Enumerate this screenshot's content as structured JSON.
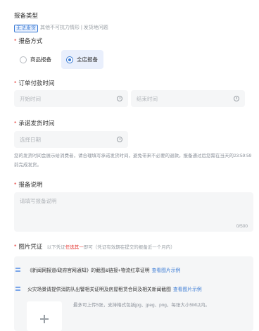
{
  "report_type": {
    "label": "报备类型",
    "selected_tag": "无法发货",
    "others": "其他不可抗力情形 | 发货地问题"
  },
  "report_method": {
    "label": "报备方式",
    "options": [
      "商品报备",
      "全店报备"
    ],
    "selected": "全店报备"
  },
  "order_paid_time": {
    "label": "订单付款时间",
    "start_placeholder": "开始时间",
    "end_placeholder": "结束时间"
  },
  "promised_ship_time": {
    "label": "承诺发货时间",
    "placeholder": "选择日期",
    "help_text": "您的发货时间会展示给消费者，请合理填写承诺发货时间，避免带来不必要的退款。报备通过后您需在当天的23:59:59前完成发货。"
  },
  "report_desc": {
    "label": "报备说明",
    "placeholder": "请填写报备说明",
    "counter": "0/500"
  },
  "image_voucher": {
    "label": "图片凭证",
    "hint_prefix": "以下凭证",
    "hint_emphasis": "任选其一",
    "hint_suffix": "即可（凭证有效期在提交的报备近一个月内）",
    "items": [
      {
        "text": "《新闻网报道/政府官网通知》的截图&链接+物流红章证明",
        "link": "查看图片示例"
      },
      {
        "text": "火灾场景请提供消防队出警相关证明及房屋租赁合同及相关新闻截图",
        "link": "查看图片示例"
      }
    ],
    "upload_tip": "最多可上传5张，支持格式包括jpg、jpeg、png，每张大小5M以内。"
  },
  "colors": {
    "accent": "#3a7bd5",
    "required": "#e53935",
    "field_bg": "#f5f6f7"
  }
}
